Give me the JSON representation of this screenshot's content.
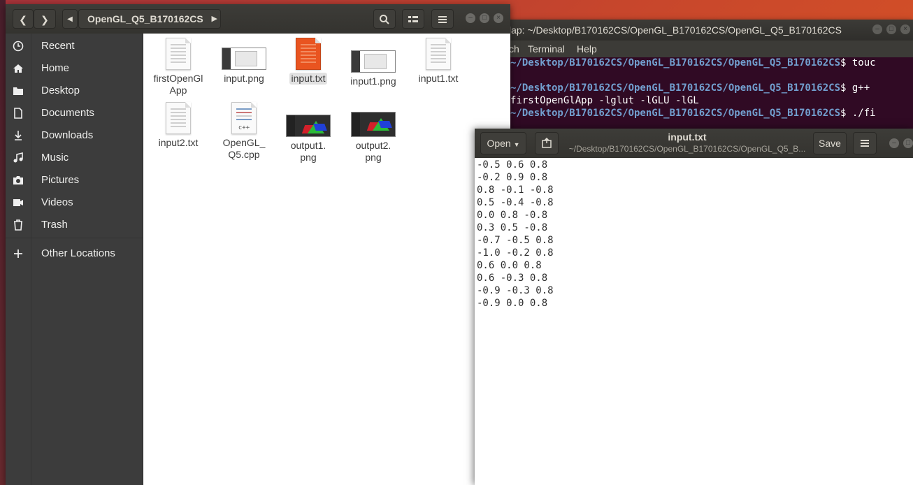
{
  "terminal": {
    "title": "lap: ~/Desktop/B170162CS/OpenGL_B170162CS/OpenGL_Q5_B170162CS",
    "menu": [
      "ch",
      "Terminal",
      "Help"
    ],
    "lines": [
      {
        "path": "~/Desktop/B170162CS/OpenGL_B170162CS/OpenGL_Q5_B170162CS",
        "cmd": "$ touc"
      },
      {
        "path": "",
        "cmd": ""
      },
      {
        "path": "~/Desktop/B170162CS/OpenGL_B170162CS/OpenGL_Q5_B170162CS",
        "cmd": "$ g++"
      },
      {
        "path": "",
        "cmd": "firstOpenGlApp -lglut -lGLU -lGL"
      },
      {
        "path": "~/Desktop/B170162CS/OpenGL_B170162CS/OpenGL_Q5_B170162CS",
        "cmd": "$ ./fi"
      }
    ]
  },
  "file_manager": {
    "breadcrumb": "OpenGL_Q5_B170162CS",
    "sidebar": [
      {
        "label": "Recent",
        "icon": "clock-icon"
      },
      {
        "label": "Home",
        "icon": "home-icon"
      },
      {
        "label": "Desktop",
        "icon": "folder-icon"
      },
      {
        "label": "Documents",
        "icon": "document-icon"
      },
      {
        "label": "Downloads",
        "icon": "download-icon"
      },
      {
        "label": "Music",
        "icon": "music-icon"
      },
      {
        "label": "Pictures",
        "icon": "camera-icon"
      },
      {
        "label": "Videos",
        "icon": "video-icon"
      },
      {
        "label": "Trash",
        "icon": "trash-icon"
      },
      {
        "label": "Other Locations",
        "icon": "plus-icon"
      }
    ],
    "files": [
      {
        "name": "firstOpenGl App",
        "line1": "firstOpenGl",
        "line2": "App",
        "kind": "doc"
      },
      {
        "name": "input.png",
        "line1": "input.png",
        "line2": "",
        "kind": "img"
      },
      {
        "name": "input.txt",
        "line1": "input.txt",
        "line2": "",
        "kind": "doc-orange"
      },
      {
        "name": "input1.png",
        "line1": "input1.png",
        "line2": "",
        "kind": "img"
      },
      {
        "name": "input1.txt",
        "line1": "input1.txt",
        "line2": "",
        "kind": "doc"
      },
      {
        "name": "input2.txt",
        "line1": "input2.txt",
        "line2": "",
        "kind": "doc"
      },
      {
        "name": "OpenGL_Q5.cpp",
        "line1": "OpenGL_",
        "line2": "Q5.cpp",
        "kind": "cpp"
      },
      {
        "name": "output1.png",
        "line1": "output1.",
        "line2": "png",
        "kind": "img-dark"
      },
      {
        "name": "output2.png",
        "line1": "output2.",
        "line2": "png",
        "kind": "img-dark"
      }
    ],
    "cpp_badge": "c++"
  },
  "gedit": {
    "open_label": "Open",
    "save_label": "Save",
    "title": "input.txt",
    "subtitle": "~/Desktop/B170162CS/OpenGL_B170162CS/OpenGL_Q5_B...",
    "content": "-0.5 0.6 0.8\n-0.2 0.9 0.8\n0.8 -0.1 -0.8\n0.5 -0.4 -0.8\n0.0 0.8 -0.8\n0.3 0.5 -0.8\n-0.7 -0.5 0.8\n-1.0 -0.2 0.8\n0.6 0.0 0.8\n0.6 -0.3 0.8\n-0.9 -0.3 0.8\n-0.9 0.0 0.8"
  },
  "colors": {
    "desktop_orange": "#e05a22",
    "terminal_bg": "#300a24",
    "terminal_path": "#729fcf",
    "selected_file": "#e95420"
  }
}
